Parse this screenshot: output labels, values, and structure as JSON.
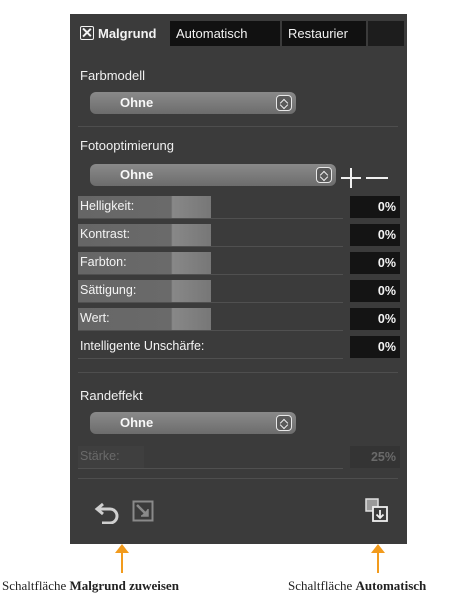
{
  "tabs": {
    "main": "Malgrund",
    "auto": "Automatisch",
    "restore": "Restaurier"
  },
  "farbmodell": {
    "label": "Farbmodell",
    "value": "Ohne"
  },
  "foto": {
    "label": "Fotooptimierung",
    "value": "Ohne"
  },
  "sliders": [
    {
      "label": "Helligkeit:",
      "value": "0%"
    },
    {
      "label": "Kontrast:",
      "value": "0%"
    },
    {
      "label": "Farbton:",
      "value": "0%"
    },
    {
      "label": "Sättigung:",
      "value": "0%"
    },
    {
      "label": "Wert:",
      "value": "0%"
    }
  ],
  "unsharp": {
    "label": "Intelligente Unschärfe:",
    "value": "0%"
  },
  "rand": {
    "label": "Randeffekt",
    "value": "Ohne"
  },
  "staerke": {
    "label": "Stärke:",
    "value": "25%"
  },
  "captions": {
    "left_prefix": "Schaltfläche",
    "left_bold": "Malgrund zuweisen",
    "right_prefix": "Schaltfläche",
    "right_bold": "Automatisch"
  },
  "colors": {
    "panel": "#3b3b3b",
    "accent_arrow": "#f29b1d"
  }
}
